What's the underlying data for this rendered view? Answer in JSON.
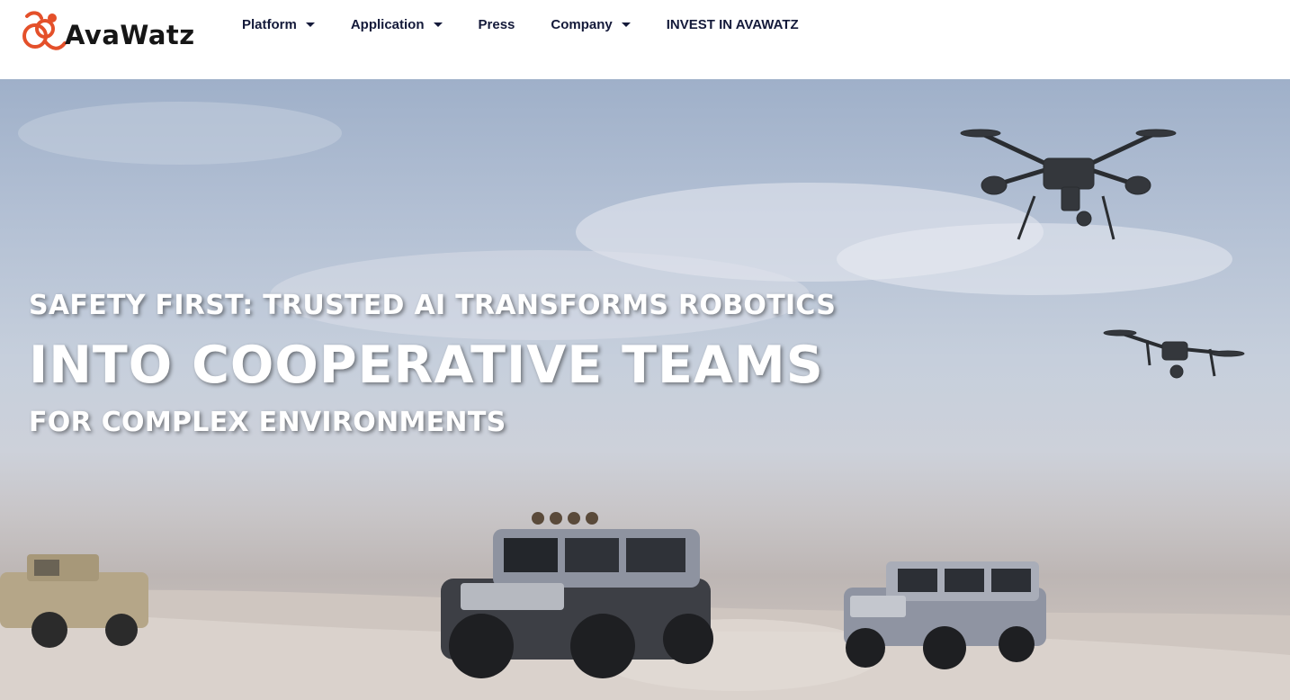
{
  "brand": {
    "name": "AvaWatz",
    "logo_text": "AvaWatz",
    "accent_color": "#e4502a"
  },
  "nav": {
    "items": [
      {
        "label": "Platform",
        "has_dropdown": true
      },
      {
        "label": "Application",
        "has_dropdown": true
      },
      {
        "label": "Press",
        "has_dropdown": false
      },
      {
        "label": "Company",
        "has_dropdown": true
      },
      {
        "label": "INVEST IN AVAWATZ",
        "has_dropdown": false
      }
    ],
    "text_color": "#141a3a"
  },
  "hero": {
    "headline_line1": "SAFETY FIRST: TRUSTED AI TRANSFORMS ROBOTICS",
    "headline_line2": "INTO COOPERATIVE TEAMS",
    "headline_line3": "FOR COMPLEX ENVIRONMENTS",
    "image_subject": "drones and off-road vehicles in a desert"
  }
}
